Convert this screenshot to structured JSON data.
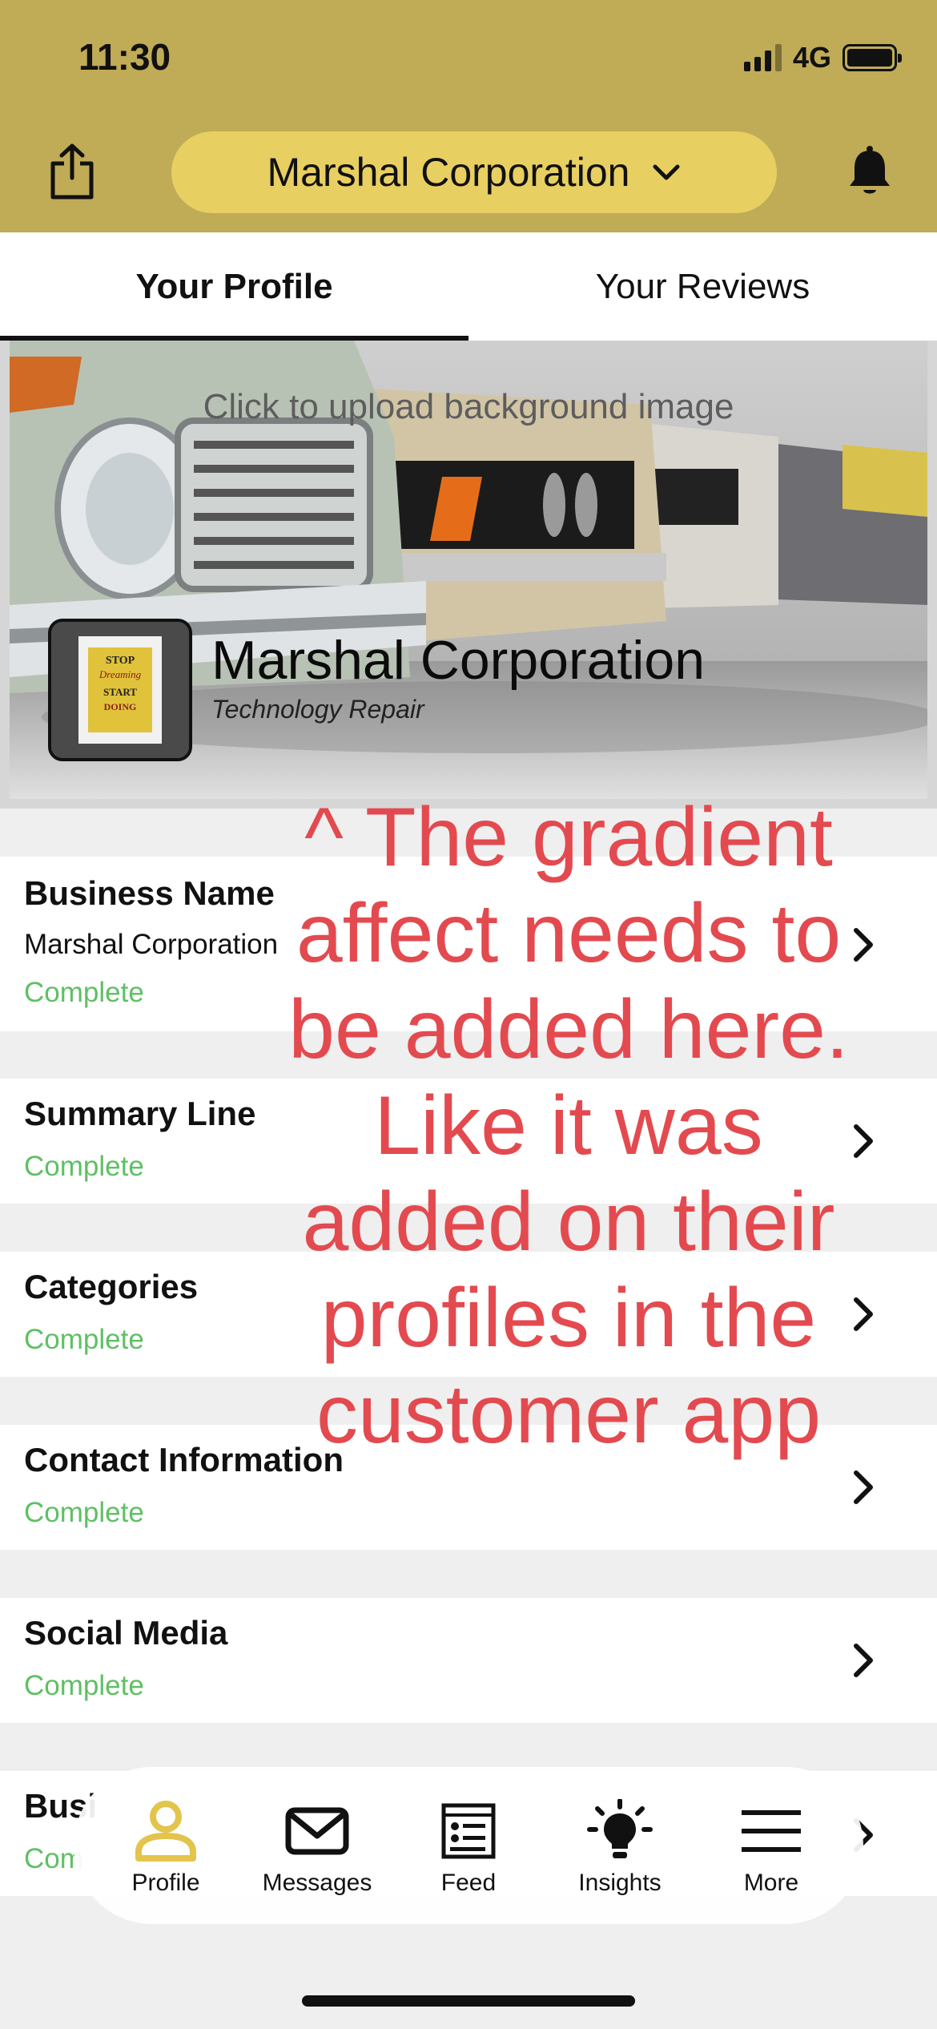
{
  "status_bar": {
    "time": "11:30",
    "network": "4G"
  },
  "header": {
    "organization": "Marshal Corporation"
  },
  "tabs": [
    {
      "label": "Your Profile",
      "active": true
    },
    {
      "label": "Your Reviews",
      "active": false
    }
  ],
  "banner": {
    "upload_hint": "Click to upload background image",
    "business_name": "Marshal Corporation",
    "category": "Technology Repair"
  },
  "sections": [
    {
      "title": "Business Name",
      "value": "Marshal Corporation",
      "status": "Complete"
    },
    {
      "title": "Summary Line",
      "status": "Complete"
    },
    {
      "title": "Categories",
      "status": "Complete"
    },
    {
      "title": "Contact Information",
      "status": "Complete"
    },
    {
      "title": "Social Media",
      "status": "Complete"
    },
    {
      "title": "Busi",
      "status": "Com"
    }
  ],
  "annotation": "^ The gradient affect needs to be added here. Like it was added on their profiles in the customer app",
  "tab_bar": [
    {
      "label": "Profile",
      "icon": "person-icon",
      "active": true
    },
    {
      "label": "Messages",
      "icon": "envelope-icon",
      "active": false
    },
    {
      "label": "Feed",
      "icon": "newspaper-icon",
      "active": false
    },
    {
      "label": "Insights",
      "icon": "lightbulb-icon",
      "active": false
    },
    {
      "label": "More",
      "icon": "hamburger-menu-icon",
      "active": false
    }
  ],
  "colors": {
    "header": "#c0ab57",
    "pill": "#e8cf62",
    "accent": "#e3c44c",
    "complete": "#5fc064",
    "annotation": "#e34a4f"
  }
}
